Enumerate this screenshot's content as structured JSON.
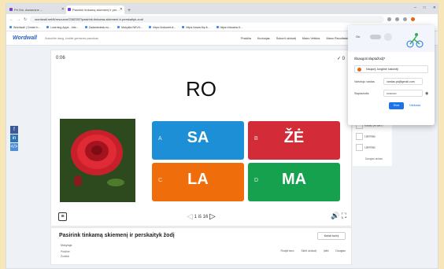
{
  "browser": {
    "tabs": [
      {
        "title": "Pri Sm. Asmenine ...",
        "active": false
      },
      {
        "title": "Pasirink tinkamą skiemenį ir per...",
        "active": true
      }
    ],
    "new_tab": "+",
    "window_controls": [
      "–",
      "□",
      "✕"
    ],
    "url": "wordwall.net/lt/resource/2362357/pasirink-tinkama-skiemeni-ir-perskaityk-zodi",
    "nav": {
      "back": "←",
      "forward": "→",
      "reload": "↻"
    },
    "bookmarks": [
      "Wordwall | Create b...",
      "Learning Apps - Inte...",
      "Zadaniedesk.eu...",
      "Mokykla NEV.lt...",
      "https://eduweb.lt...",
      "https://www.fhp.lt...",
      "https://oksana.lt..."
    ],
    "ext_colors": [
      "#9aa0a6",
      "#9aa0a6",
      "#9aa0a6",
      "#e0661a"
    ]
  },
  "site": {
    "logo": "Wordwall",
    "tagline": "Sukurkite daug, kurkite geresnes pamokas",
    "nav": [
      "Pradžia",
      "Kuriuojas",
      "Sukurti užduotį",
      "Mano Veiklos",
      "Mano Rezultatai"
    ]
  },
  "game": {
    "timer": "0:06",
    "score_icon": "✓",
    "score": "0",
    "prompt": "RO",
    "answers": [
      {
        "letter": "A",
        "text": "SA",
        "color": "#1c8fd6"
      },
      {
        "letter": "B",
        "text": "ŽĖ",
        "color": "#d42b39"
      },
      {
        "letter": "C",
        "text": "LA",
        "color": "#f06d0c"
      },
      {
        "letter": "D",
        "text": "MA",
        "color": "#16a14f"
      }
    ],
    "page_prev": "◁",
    "page_current": "1",
    "page_sep": "iš",
    "page_total": "16",
    "page_next": "▷",
    "sound_icon": "🔊",
    "fullscreen_icon": "⛶",
    "menu_icon": "≡"
  },
  "activity": {
    "title": "Pasirink tinkamą skiemenį ir perskaityk žodį",
    "edit_label": "Keisti turinį",
    "author": "Mokytoja",
    "meta1": "Pradinė",
    "meta2": "Žodžiai",
    "actions": [
      "Rodyti tavo",
      "Skirti užduotį",
      "Įdėti",
      "Daugiau"
    ]
  },
  "social": [
    {
      "label": "f",
      "color": "#3b5998"
    },
    {
      "label": "in",
      "color": "#2d78b4"
    },
    {
      "label": "</>",
      "color": "#4f8fd6"
    }
  ],
  "password_popup": {
    "title": "Išsaugoti slaptažodį?",
    "account": "Naujorij Jungtinė lustonėji",
    "username_label": "Vartotojo vardas",
    "username_value": "vardas.pa@gmail.com",
    "password_label": "Slaptažodis",
    "password_value": "••••••••••",
    "save_label": "Ekst",
    "never_label": "Niekada",
    "toggle": "On",
    "accent": "#1a73e8"
  },
  "side_panel": {
    "items": [
      "Anagrama",
      "Kalbas (Ar laik?)",
      "Labirintas",
      "Labirintas"
    ],
    "caption": "Daugiau anksto"
  }
}
